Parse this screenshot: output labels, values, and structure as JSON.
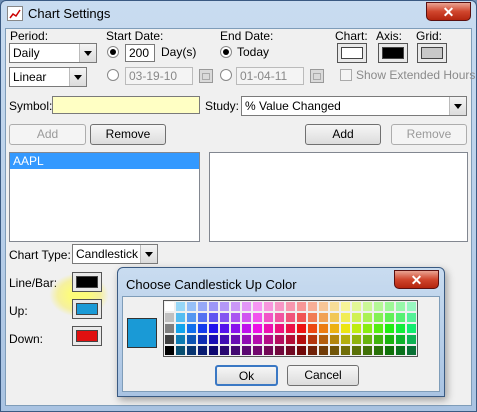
{
  "window": {
    "title": "Chart Settings",
    "close_glyph": "✕"
  },
  "period": {
    "label": "Period:",
    "value": "Daily",
    "scale_value": "Linear"
  },
  "start_date": {
    "label": "Start Date:",
    "days_value": "200",
    "days_unit": "Day(s)",
    "date_value": "03-19-10"
  },
  "end_date": {
    "label": "End Date:",
    "today_label": "Today",
    "date_value": "01-04-11"
  },
  "colors_header": {
    "chart_label": "Chart:",
    "axis_label": "Axis:",
    "grid_label": "Grid:",
    "chart_color": "#ffffff",
    "axis_color": "#000000",
    "grid_color": "#c8c8c8"
  },
  "show_extended_hours": "Show Extended Hours",
  "symbol": {
    "label": "Symbol:",
    "value": ""
  },
  "study": {
    "label": "Study:",
    "value": "% Value Changed"
  },
  "buttons": {
    "add_left": "Add",
    "remove_left": "Remove",
    "add_right": "Add",
    "remove_right": "Remove"
  },
  "symbols_list": [
    "AAPL"
  ],
  "chart_type": {
    "label": "Chart Type:",
    "value": "Candlestick"
  },
  "line_bar": {
    "label": "Line/Bar:",
    "color": "#000000"
  },
  "up": {
    "label": "Up:",
    "color": "#1a9ad6"
  },
  "down": {
    "label": "Down:",
    "color": "#e01010"
  },
  "dialog": {
    "title": "Choose Candlestick Up Color",
    "close_glyph": "✕",
    "selected_color": "#1a9ad6",
    "ok_label": "Ok",
    "cancel_label": "Cancel"
  }
}
